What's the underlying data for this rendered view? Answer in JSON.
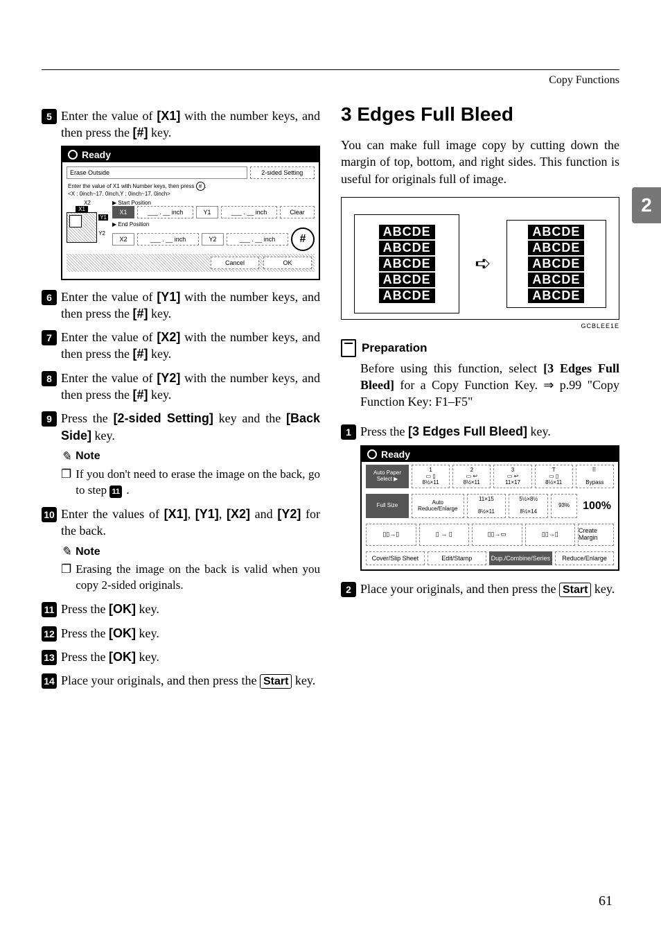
{
  "header": {
    "category": "Copy Functions"
  },
  "side_tab": "2",
  "page_number": "61",
  "left": {
    "steps": {
      "s5": {
        "num": "5",
        "pre": "Enter the value of ",
        "key": "[X1]",
        "mid": " with the number keys, and then press the ",
        "hash": "[#]",
        "post": " key."
      },
      "s6": {
        "num": "6",
        "pre": "Enter the value of ",
        "key": "[Y1]",
        "mid": " with the number keys, and then press the ",
        "hash": "[#]",
        "post": " key."
      },
      "s7": {
        "num": "7",
        "pre": "Enter the value of ",
        "key": "[X2]",
        "mid": " with the number keys, and then press the ",
        "hash": "[#]",
        "post": " key."
      },
      "s8": {
        "num": "8",
        "pre": "Enter the value of ",
        "key": "[Y2]",
        "mid": " with the number keys, and then press the ",
        "hash": "[#]",
        "post": " key."
      },
      "s9": {
        "num": "9",
        "pre": "Press the ",
        "key1": "[2-sided Setting]",
        "mid": " key and the ",
        "key2": "[Back Side]",
        "post": " key."
      },
      "s10": {
        "num": "10",
        "pre": "Enter the values of ",
        "k1": "[X1]",
        "c1": ", ",
        "k2": "[Y1]",
        "c2": ", ",
        "k3": "[X2]",
        "mid": " and ",
        "k4": "[Y2]",
        "post": " for the back."
      },
      "s11": {
        "num": "11",
        "pre": "Press the ",
        "key": "[OK]",
        "post": " key."
      },
      "s12": {
        "num": "12",
        "pre": "Press the ",
        "key": "[OK]",
        "post": " key."
      },
      "s13": {
        "num": "13",
        "pre": "Press the ",
        "key": "[OK]",
        "post": " key."
      },
      "s14": {
        "num": "14",
        "pre": "Place your originals, and then press the ",
        "start": "Start",
        "post": " key."
      }
    },
    "note_label": "Note",
    "note1": {
      "pre": "If you don't need to erase the image on the back, go to step ",
      "ref": "11",
      "post": "."
    },
    "note2": "Erasing the image on the back is valid when you copy 2-sided originals.",
    "figure": {
      "ready": "Ready",
      "title": "Erase Outside",
      "btn_2sided": "2-sided Setting",
      "instruction": "Enter the value of X1 with Number keys, then press",
      "range": "<X : 0inch~17. 0inch,Y : 0inch~17. 0inch>",
      "x2_lbl": "X2",
      "x1_lbl": "X1",
      "y1_lbl": "Y1",
      "y2_lbl": "Y2",
      "start_pos": "▶ Start Position",
      "end_pos": "▶ End Position",
      "X1": "X1",
      "Y1": "Y1",
      "X2": "X2",
      "Y2": "Y2",
      "unit": "inch",
      "dot": "___ . __",
      "clear": "Clear",
      "hash": "#",
      "cancel": "Cancel",
      "ok": "OK"
    }
  },
  "right": {
    "title": "3 Edges Full Bleed",
    "intro": "You can make full image copy by cutting down the margin of top, bottom, and right sides. This function is useful for originals full of image.",
    "diagram": {
      "text": "ABCDE",
      "arrow": "➪",
      "caption": "GCBLEE1E"
    },
    "prep_label": "Preparation",
    "prep_text": {
      "pre": "Before using this function, select ",
      "key": "[3 Edges Full Bleed]",
      "mid": " for a Copy Function Key. ⇒ p.99 \"Copy Function Key: F1–F5\""
    },
    "steps": {
      "s1": {
        "num": "1",
        "pre": "Press the ",
        "key": "[3 Edges Full Bleed]",
        "post": " key."
      },
      "s2": {
        "num": "2",
        "pre": "Place your originals, and then press the ",
        "start": "Start",
        "post": " key."
      }
    },
    "figure": {
      "ready": "Ready",
      "auto_paper": "Auto Paper Select ▶",
      "tray1a": "1",
      "tray1b": "8½×11",
      "tray2a": "2",
      "tray2b": "8½×11",
      "tray3a": "3",
      "tray3b": "11×17",
      "tray4a": "T",
      "tray4b": "8½×11",
      "bypass": "Bypass",
      "full_size": "Full Size",
      "auto_re": "Auto Reduce/Enlarge",
      "ratio1a": "11×15",
      "ratio1b": "8½×11",
      "ratio2a": "5½×8½",
      "ratio2b": "8½×14",
      "pct": "93%",
      "hundred": "100%",
      "arrow": "→",
      "create_margin": "Create Margin",
      "cover": "Cover/Slip Sheet",
      "edit": "Edit/Stamp",
      "dup": "Dup./Combine/Series",
      "reduce": "Reduce/Enlarge"
    }
  }
}
